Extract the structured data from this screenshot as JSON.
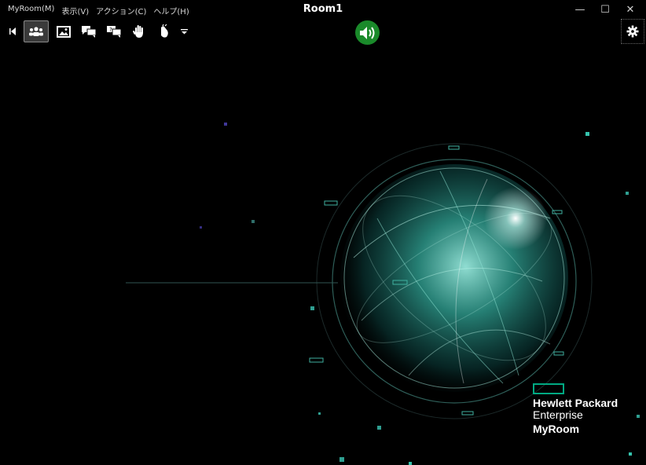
{
  "window": {
    "title": "Room1",
    "menu": [
      {
        "label": "MyRoom(M)"
      },
      {
        "label": "表示(V)"
      },
      {
        "label": "アクション(C)"
      },
      {
        "label": "ヘルプ(H)"
      }
    ],
    "controls": {
      "minimize": "—",
      "maximize": "☐",
      "close": "✕"
    }
  },
  "toolbar": {
    "icons": [
      "collapse-arrow-icon",
      "participants-icon",
      "image-icon",
      "chat-icon",
      "chat-question-icon",
      "raise-hand-icon",
      "clap-hands-icon",
      "dropdown-arrow-icon"
    ],
    "active": "participants-icon",
    "speaker_color": "#1a8a2a"
  },
  "logo": {
    "line1": "Hewlett Packard",
    "line2": "Enterprise",
    "line3": "MyRoom",
    "accent": "#01a982"
  }
}
